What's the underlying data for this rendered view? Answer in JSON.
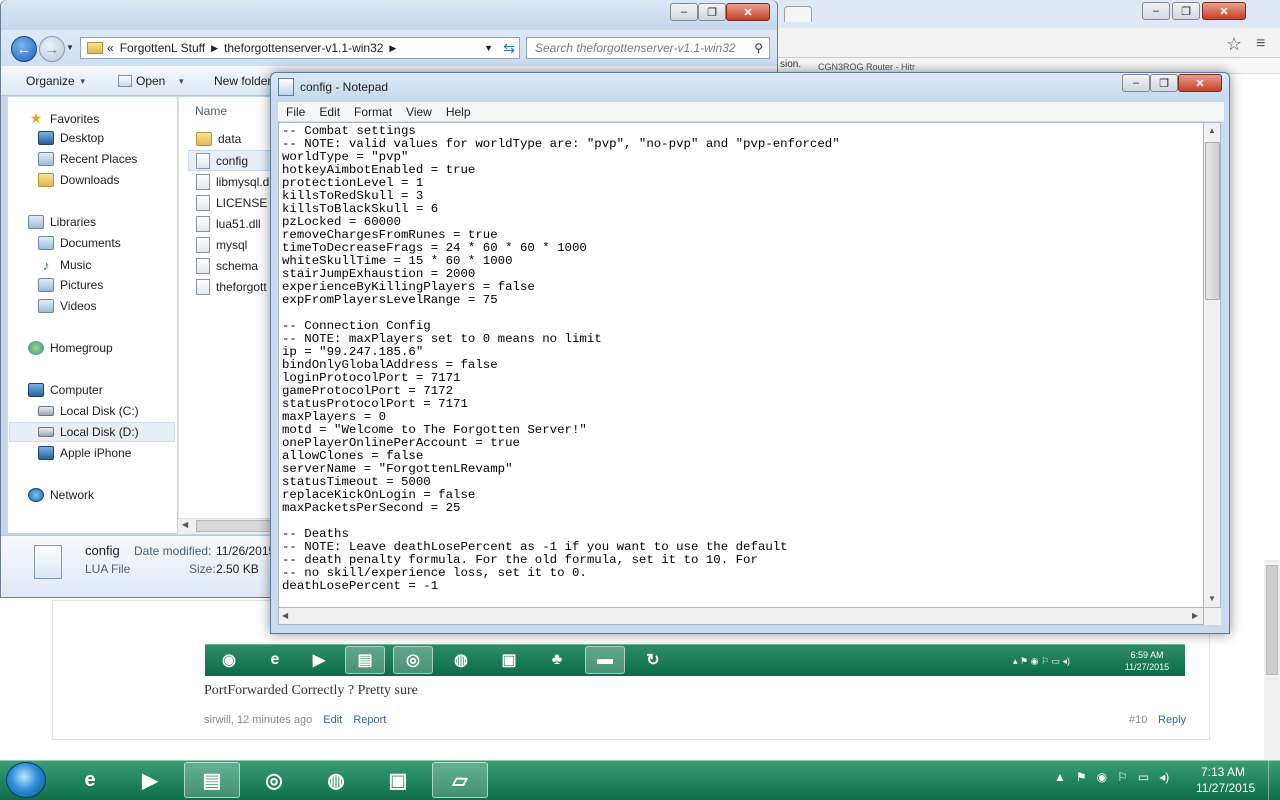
{
  "browser": {
    "bookmark_text": "sion.",
    "bookmark_tab2": "CGN3ROG Router - Hitr"
  },
  "explorer": {
    "breadcrumb_prefix": "«",
    "breadcrumb": [
      "ForgottenL Stuff",
      "theforgottenserver-v1.1-win32"
    ],
    "search_placeholder": "Search theforgottenserver-v1.1-win32",
    "toolbar": {
      "organize": "Organize",
      "open": "Open",
      "new_folder": "New folder"
    },
    "column_name": "Name",
    "nav": {
      "favorites": "Favorites",
      "desktop": "Desktop",
      "recent_places": "Recent Places",
      "downloads": "Downloads",
      "libraries": "Libraries",
      "documents": "Documents",
      "music": "Music",
      "pictures": "Pictures",
      "videos": "Videos",
      "homegroup": "Homegroup",
      "computer": "Computer",
      "local_disk_c": "Local Disk (C:)",
      "local_disk_d": "Local Disk (D:)",
      "apple_iphone": "Apple iPhone",
      "network": "Network"
    },
    "files": [
      "data",
      "config",
      "libmysql.d",
      "LICENSE",
      "lua51.dll",
      "mysql",
      "schema",
      "theforgott"
    ],
    "details": {
      "name": "config",
      "type": "LUA File",
      "modified_label": "Date modified:",
      "modified_value": "11/26/2015",
      "size_label": "Size:",
      "size_value": "2.50 KB"
    }
  },
  "notepad": {
    "title": "config - Notepad",
    "menu": [
      "File",
      "Edit",
      "Format",
      "View",
      "Help"
    ],
    "lines": [
      "-- Combat settings",
      "-- NOTE: valid values for worldType are: \"pvp\", \"no-pvp\" and \"pvp-enforced\"",
      "worldType = \"pvp\"",
      "hotkeyAimbotEnabled = true",
      "protectionLevel = 1",
      "killsToRedSkull = 3",
      "killsToBlackSkull = 6",
      "pzLocked = 60000",
      "removeChargesFromRunes = true",
      "timeToDecreaseFrags = 24 * 60 * 60 * 1000",
      "whiteSkullTime = 15 * 60 * 1000",
      "stairJumpExhaustion = 2000",
      "experienceByKillingPlayers = false",
      "expFromPlayersLevelRange = 75",
      "",
      "-- Connection Config",
      "-- NOTE: maxPlayers set to 0 means no limit",
      "ip = \"99.247.185.6\"",
      "bindOnlyGlobalAddress = false",
      "loginProtocolPort = 7171",
      "gameProtocolPort = 7172",
      "statusProtocolPort = 7171",
      "maxPlayers = 0",
      "motd = \"Welcome to The Forgotten Server!\"",
      "onePlayerOnlinePerAccount = true",
      "allowClones = false",
      "serverName = \"ForgottenLRevamp\"",
      "statusTimeout = 5000",
      "replaceKickOnLogin = false",
      "maxPacketsPerSecond = 25",
      "",
      "-- Deaths",
      "-- NOTE: Leave deathLosePercent as -1 if you want to use the default",
      "-- death penalty formula. For the old formula, set it to 10. For",
      "-- no skill/experience loss, set it to 0.",
      "deathLosePercent = -1"
    ]
  },
  "forum": {
    "post_text": "PortForwarded Correctly ? Pretty sure",
    "author_time": "sirwill, 12 minutes ago",
    "edit": "Edit",
    "report": "Report",
    "post_number": "#10",
    "reply": "Reply",
    "embedded_clock_time": "6:59 AM",
    "embedded_clock_date": "11/27/2015"
  },
  "taskbar": {
    "time": "7:13 AM",
    "date": "11/27/2015"
  }
}
